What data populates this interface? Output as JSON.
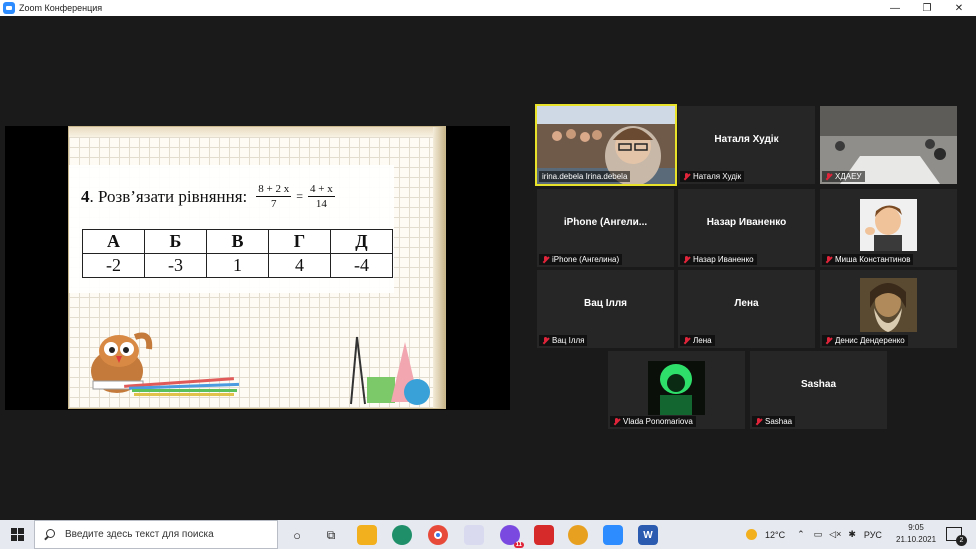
{
  "window": {
    "title": "Zoom Конференция",
    "controls": {
      "minimize": "—",
      "restore": "❐",
      "close": "✕"
    }
  },
  "slide": {
    "task_number": "4",
    "task_text": ". Розв’язати рівняння:",
    "equation": {
      "left_num": "8 + 2 x",
      "left_den": "7",
      "eq": "=",
      "right_num": "4 + x",
      "right_den": "14"
    },
    "answers": {
      "headers": [
        "А",
        "Б",
        "В",
        "Г",
        "Д"
      ],
      "values": [
        "-2",
        "-3",
        "1",
        "4",
        "-4"
      ]
    }
  },
  "participants": [
    {
      "name": "irina.debela Irina.debela",
      "display": "",
      "video": true,
      "active": true,
      "muted": false
    },
    {
      "name": "Наталя Худік",
      "display": "Наталя Худік",
      "video": false,
      "muted": true
    },
    {
      "name": "ХДАЕУ",
      "display": "",
      "video": true,
      "muted": true
    },
    {
      "name": "iPhone (Ангелина)",
      "display": "iPhone  (Ангели...",
      "video": false,
      "muted": true
    },
    {
      "name": "Назар Иваненко",
      "display": "Назар Иваненко",
      "video": false,
      "muted": true
    },
    {
      "name": "Миша Константинов",
      "display": "",
      "video": true,
      "muted": true
    },
    {
      "name": "Вац Ілля",
      "display": "Вац Ілля",
      "video": false,
      "muted": true
    },
    {
      "name": "Лена",
      "display": "Лена",
      "video": false,
      "muted": true
    },
    {
      "name": "Денис Дендеренко",
      "display": "",
      "video": true,
      "muted": true
    },
    {
      "name": "Vlada Ponomariova",
      "display": "",
      "video": true,
      "muted": true
    },
    {
      "name": "Sashaa",
      "display": "Sashaa",
      "video": false,
      "muted": true
    }
  ],
  "taskbar": {
    "search_placeholder": "Введите здесь текст для поиска",
    "weather": "12°C",
    "language": "РУС",
    "time": "9:05",
    "date": "21.10.2021",
    "notifications": "2",
    "viber_badge": "11"
  },
  "colors": {
    "active_speaker": "#e8e22a",
    "muted_icon": "#e0243a",
    "zoom_blue": "#2d8cff"
  }
}
